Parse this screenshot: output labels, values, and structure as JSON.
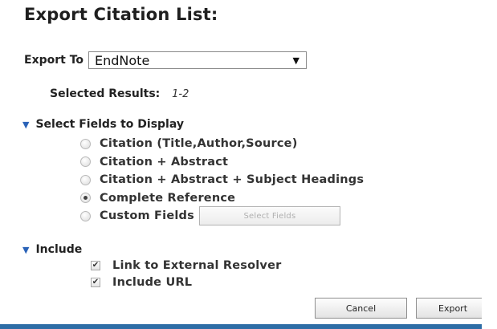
{
  "dialog": {
    "title": "Export Citation List:",
    "export_to_label": "Export To",
    "export_to_value": "EndNote",
    "selected_results_label": "Selected Results:",
    "selected_results_value": "1-2",
    "fields_section": {
      "heading": "Select Fields to Display",
      "options": [
        {
          "label": "Citation (Title,Author,Source)",
          "checked": false
        },
        {
          "label": "Citation + Abstract",
          "checked": false
        },
        {
          "label": "Citation + Abstract + Subject Headings",
          "checked": false
        },
        {
          "label": "Complete Reference",
          "checked": true
        },
        {
          "label": "Custom Fields",
          "checked": false
        }
      ],
      "select_fields_button": "Select Fields"
    },
    "include_section": {
      "heading": "Include",
      "options": [
        {
          "label": "Link to External Resolver",
          "checked": true
        },
        {
          "label": "Include URL",
          "checked": true
        }
      ]
    },
    "buttons": {
      "cancel": "Cancel",
      "export": "Export"
    }
  },
  "colors": {
    "accent": "#2a63b8",
    "bottom_bar": "#2d6da6"
  }
}
